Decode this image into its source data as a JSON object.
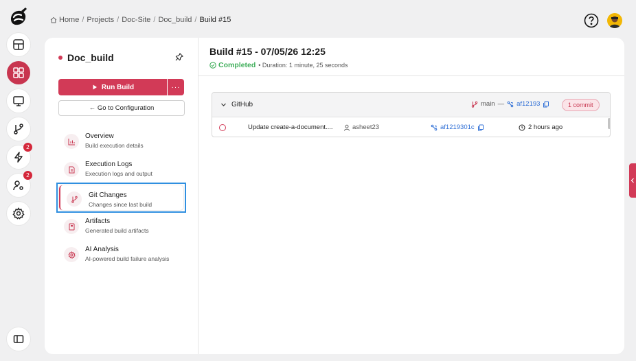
{
  "breadcrumb": {
    "items": [
      "Home",
      "Projects",
      "Doc-Site",
      "Doc_build"
    ],
    "current": "Build #15",
    "separator": "/"
  },
  "rail": {
    "icons": [
      "app-logo",
      "dashboard-icon",
      "grid-icon",
      "monitor-icon",
      "git-branch-icon",
      "lightning-icon",
      "user-settings-icon",
      "settings-icon",
      "sidebar-toggle-icon"
    ],
    "lightning_badge": "2",
    "user_settings_badge": "2"
  },
  "project": {
    "name": "Doc_build",
    "run_label": "Run Build",
    "more_label": "···",
    "config_label": "← Go to Configuration"
  },
  "nav": [
    {
      "title": "Overview",
      "subtitle": "Build execution details",
      "icon": "chart-icon"
    },
    {
      "title": "Execution Logs",
      "subtitle": "Execution logs and output",
      "icon": "file-icon"
    },
    {
      "title": "Git Changes",
      "subtitle": "Changes since last build",
      "icon": "git-branch-icon",
      "selected": true
    },
    {
      "title": "Artifacts",
      "subtitle": "Generated build artifacts",
      "icon": "document-icon"
    },
    {
      "title": "AI Analysis",
      "subtitle": "AI-powered build failure analysis",
      "icon": "gear-icon"
    }
  ],
  "build": {
    "title": "Build #15 - 07/05/26 12:25",
    "status": "Completed",
    "duration": "• Duration: 1 minute, 25 seconds"
  },
  "git": {
    "provider": "GitHub",
    "branch": "main",
    "dash": "—",
    "head_sha": "af12193",
    "commit_count": "1 commit",
    "commits": [
      {
        "message": "Update create-a-document....",
        "author": "asheet23",
        "sha": "af1219301c",
        "time": "2 hours ago"
      }
    ]
  },
  "colors": {
    "accent": "#d23a57",
    "success": "#3fae5a",
    "link": "#2f6fd6",
    "selection": "#2f8fe0"
  }
}
